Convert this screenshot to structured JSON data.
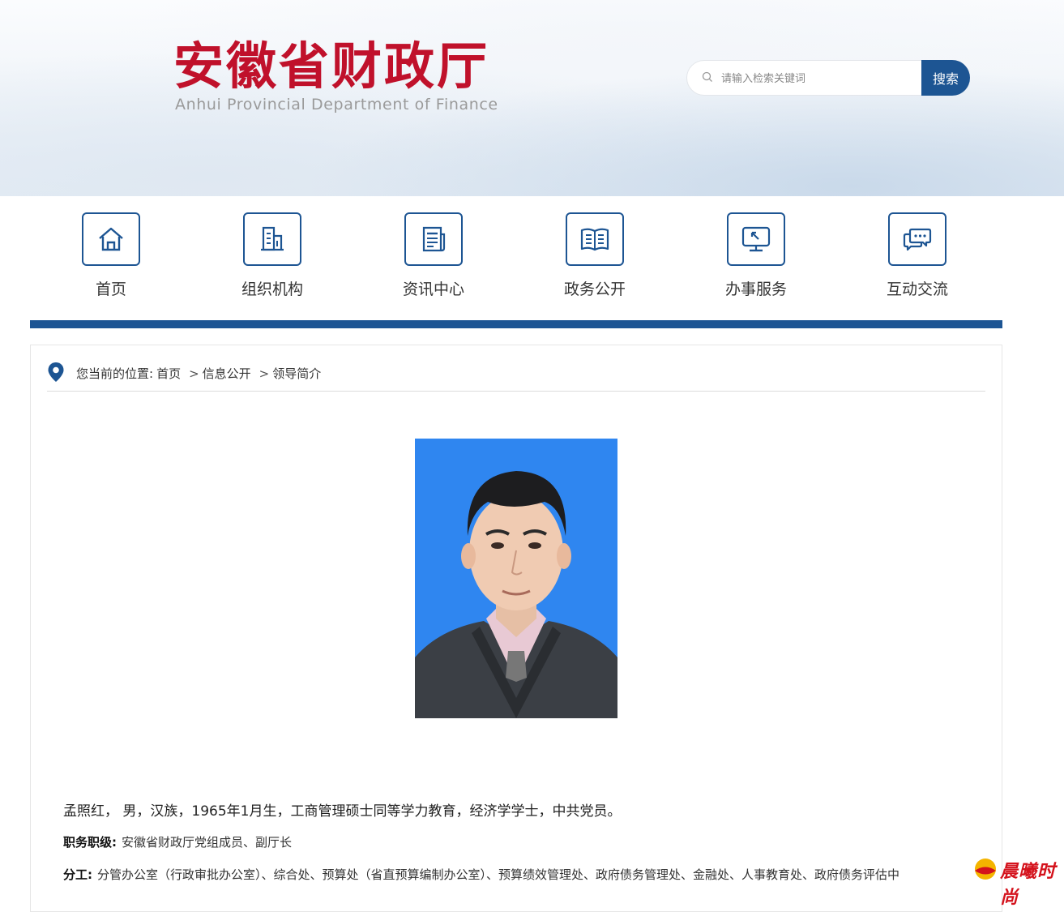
{
  "header": {
    "logo_cn": "安徽省财政厅",
    "logo_en": "Anhui Provincial Department of Finance",
    "search_placeholder": "请输入检索关键词",
    "search_button": "搜索"
  },
  "nav": {
    "items": [
      {
        "label": "首页",
        "icon": "home-icon"
      },
      {
        "label": "组织机构",
        "icon": "building-icon"
      },
      {
        "label": "资讯中心",
        "icon": "news-icon"
      },
      {
        "label": "政务公开",
        "icon": "book-icon"
      },
      {
        "label": "办事服务",
        "icon": "monitor-icon"
      },
      {
        "label": "互动交流",
        "icon": "chat-icon"
      }
    ]
  },
  "breadcrumb": {
    "prefix": "您当前的位置:",
    "items": [
      "首页",
      "信息公开",
      "领导简介"
    ],
    "separator": ">"
  },
  "profile": {
    "bio": "孟照红， 男，汉族，1965年1月生，工商管理硕士同等学力教育，经济学学士，中共党员。",
    "position_label": "职务职级:",
    "position_value": "安徽省财政厅党组成员、副厅长",
    "duty_label": "分工:",
    "duty_value": "分管办公室（行政审批办公室）、综合处、预算处（省直预算编制办公室）、预算绩效管理处、政府债务管理处、金融处、人事教育处、政府债务评估中"
  },
  "watermark": {
    "text": "晨曦时尚"
  },
  "colors": {
    "brand_red": "#c0112b",
    "brand_blue": "#1d5593",
    "portrait_bg": "#2f86f0"
  }
}
